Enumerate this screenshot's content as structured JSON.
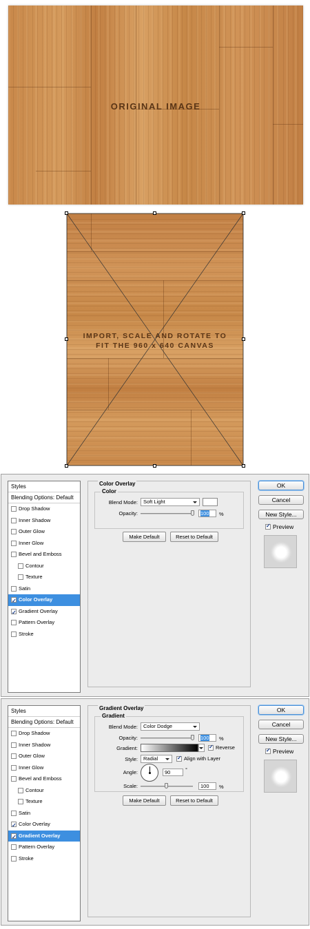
{
  "original_image": {
    "label": "ORIGINAL IMAGE"
  },
  "transformed_image": {
    "label_line1": "IMPORT, SCALE AND ROTATE TO",
    "label_line2": "FIT THE 960 x 640 CANVAS"
  },
  "dialogs": [
    {
      "styles_header": "Styles",
      "blending_options": "Blending Options: Default",
      "items": [
        {
          "label": "Drop Shadow",
          "checked": false,
          "selected": false,
          "indent": false
        },
        {
          "label": "Inner Shadow",
          "checked": false,
          "selected": false,
          "indent": false
        },
        {
          "label": "Outer Glow",
          "checked": false,
          "selected": false,
          "indent": false
        },
        {
          "label": "Inner Glow",
          "checked": false,
          "selected": false,
          "indent": false
        },
        {
          "label": "Bevel and Emboss",
          "checked": false,
          "selected": false,
          "indent": false
        },
        {
          "label": "Contour",
          "checked": false,
          "selected": false,
          "indent": true
        },
        {
          "label": "Texture",
          "checked": false,
          "selected": false,
          "indent": true
        },
        {
          "label": "Satin",
          "checked": false,
          "selected": false,
          "indent": false
        },
        {
          "label": "Color Overlay",
          "checked": true,
          "selected": true,
          "indent": false
        },
        {
          "label": "Gradient Overlay",
          "checked": true,
          "selected": false,
          "indent": false
        },
        {
          "label": "Pattern Overlay",
          "checked": false,
          "selected": false,
          "indent": false
        },
        {
          "label": "Stroke",
          "checked": false,
          "selected": false,
          "indent": false
        }
      ],
      "panel_title": "Color Overlay",
      "group_title": "Color",
      "blend_mode_label": "Blend Mode:",
      "blend_mode_value": "Soft Light",
      "opacity_label": "Opacity:",
      "opacity_value": "100",
      "opacity_unit": "%",
      "opacity_fraction": 1.0,
      "swatch_color": "#ffffff",
      "make_default": "Make Default",
      "reset_default": "Reset to Default",
      "ok": "OK",
      "cancel": "Cancel",
      "new_style": "New Style...",
      "preview": "Preview",
      "preview_checked": true
    },
    {
      "styles_header": "Styles",
      "blending_options": "Blending Options: Default",
      "items": [
        {
          "label": "Drop Shadow",
          "checked": false,
          "selected": false,
          "indent": false
        },
        {
          "label": "Inner Shadow",
          "checked": false,
          "selected": false,
          "indent": false
        },
        {
          "label": "Outer Glow",
          "checked": false,
          "selected": false,
          "indent": false
        },
        {
          "label": "Inner Glow",
          "checked": false,
          "selected": false,
          "indent": false
        },
        {
          "label": "Bevel and Emboss",
          "checked": false,
          "selected": false,
          "indent": false
        },
        {
          "label": "Contour",
          "checked": false,
          "selected": false,
          "indent": true
        },
        {
          "label": "Texture",
          "checked": false,
          "selected": false,
          "indent": true
        },
        {
          "label": "Satin",
          "checked": false,
          "selected": false,
          "indent": false
        },
        {
          "label": "Color Overlay",
          "checked": true,
          "selected": false,
          "indent": false
        },
        {
          "label": "Gradient Overlay",
          "checked": true,
          "selected": true,
          "indent": false
        },
        {
          "label": "Pattern Overlay",
          "checked": false,
          "selected": false,
          "indent": false
        },
        {
          "label": "Stroke",
          "checked": false,
          "selected": false,
          "indent": false
        }
      ],
      "panel_title": "Gradient Overlay",
      "group_title": "Gradient",
      "blend_mode_label": "Blend Mode:",
      "blend_mode_value": "Color Dodge",
      "opacity_label": "Opacity:",
      "opacity_value": "100",
      "opacity_unit": "%",
      "opacity_fraction": 1.0,
      "gradient_label": "Gradient:",
      "reverse_label": "Reverse",
      "reverse_checked": true,
      "style_label": "Style:",
      "style_value": "Radial",
      "align_label": "Align with Layer",
      "align_checked": true,
      "angle_label": "Angle:",
      "angle_value": "90",
      "angle_unit": "°",
      "scale_label": "Scale:",
      "scale_value": "100",
      "scale_unit": "%",
      "scale_fraction": 0.5,
      "make_default": "Make Default",
      "reset_default": "Reset to Default",
      "ok": "OK",
      "cancel": "Cancel",
      "new_style": "New Style...",
      "preview": "Preview",
      "preview_checked": true
    }
  ]
}
